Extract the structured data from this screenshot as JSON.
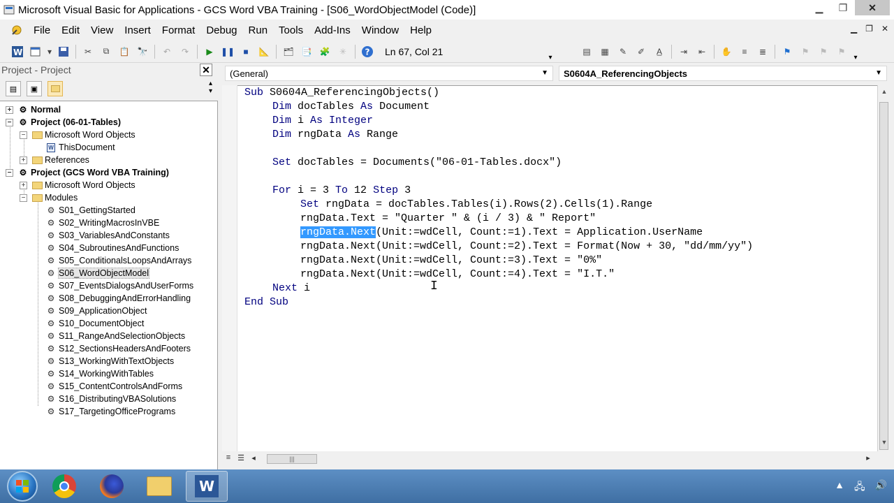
{
  "window": {
    "title": "Microsoft Visual Basic for Applications - GCS Word VBA Training - [S06_WordObjectModel (Code)]"
  },
  "menu": {
    "items": [
      "File",
      "Edit",
      "View",
      "Insert",
      "Format",
      "Debug",
      "Run",
      "Tools",
      "Add-Ins",
      "Window",
      "Help"
    ]
  },
  "toolbar": {
    "position": "Ln 67, Col 21"
  },
  "project": {
    "pane_title": "Project - Project",
    "close_label": "✕",
    "tree": [
      {
        "label": "Normal",
        "bold": true
      },
      {
        "label": "Project (06-01-Tables)",
        "bold": true
      },
      {
        "label": "Microsoft Word Objects"
      },
      {
        "label": "ThisDocument"
      },
      {
        "label": "References"
      },
      {
        "label": "Project (GCS Word VBA Training)",
        "bold": true
      },
      {
        "label": "Microsoft Word Objects"
      },
      {
        "label": "Modules"
      },
      {
        "label": "S01_GettingStarted"
      },
      {
        "label": "S02_WritingMacrosInVBE"
      },
      {
        "label": "S03_VariablesAndConstants"
      },
      {
        "label": "S04_SubroutinesAndFunctions"
      },
      {
        "label": "S05_ConditionalsLoopsAndArrays"
      },
      {
        "label": "S06_WordObjectModel",
        "selected": true
      },
      {
        "label": "S07_EventsDialogsAndUserForms"
      },
      {
        "label": "S08_DebuggingAndErrorHandling"
      },
      {
        "label": "S09_ApplicationObject"
      },
      {
        "label": "S10_DocumentObject"
      },
      {
        "label": "S11_RangeAndSelectionObjects"
      },
      {
        "label": "S12_SectionsHeadersAndFooters"
      },
      {
        "label": "S13_WorkingWithTextObjects"
      },
      {
        "label": "S14_WorkingWithTables"
      },
      {
        "label": "S15_ContentControlsAndForms"
      },
      {
        "label": "S16_DistributingVBASolutions"
      },
      {
        "label": "S17_TargetingOfficePrograms"
      }
    ]
  },
  "code": {
    "object_combo": "(General)",
    "procedure_combo": "S0604A_ReferencingObjects",
    "lines": {
      "l1_kw": "Sub",
      "l1_rest": " S0604A_ReferencingObjects()",
      "l2_kw1": "Dim",
      "l2_mid": " docTables ",
      "l2_kw2": "As",
      "l2_rest": " Document",
      "l3_kw1": "Dim",
      "l3_mid": " i ",
      "l3_kw2": "As Integer",
      "l4_kw1": "Dim",
      "l4_mid": " rngData ",
      "l4_kw2": "As",
      "l4_rest": " Range",
      "l5_kw": "Set",
      "l5_rest": " docTables = Documents(\"06-01-Tables.docx\")",
      "l6_kw1": "For",
      "l6_mid": " i = 3 ",
      "l6_kw2": "To",
      "l6_mid2": " 12 ",
      "l6_kw3": "Step",
      "l6_rest": " 3",
      "l7_kw": "Set",
      "l7_rest": " rngData = docTables.Tables(i).Rows(2).Cells(1).Range",
      "l8": "rngData.Text = \"Quarter \" & (i / 3) & \" Report\"",
      "l9_sel": "rngData.Next",
      "l9_rest": "(Unit:=wdCell, Count:=1).Text = Application.UserName",
      "l10": "rngData.Next(Unit:=wdCell, Count:=2).Text = Format(Now + 30, \"dd/mm/yy\")",
      "l11": "rngData.Next(Unit:=wdCell, Count:=3).Text = \"0%\"",
      "l12": "rngData.Next(Unit:=wdCell, Count:=4).Text = \"I.T.\"",
      "l13_kw": "Next",
      "l13_rest": " i",
      "l14_kw": "End Sub"
    }
  },
  "colors": {
    "keyword": "#00007f",
    "selection": "#3399ff"
  },
  "taskbar": {
    "apps": [
      "start-orb",
      "chrome-icon",
      "firefox-icon",
      "file-explorer-icon",
      "word-icon"
    ]
  }
}
